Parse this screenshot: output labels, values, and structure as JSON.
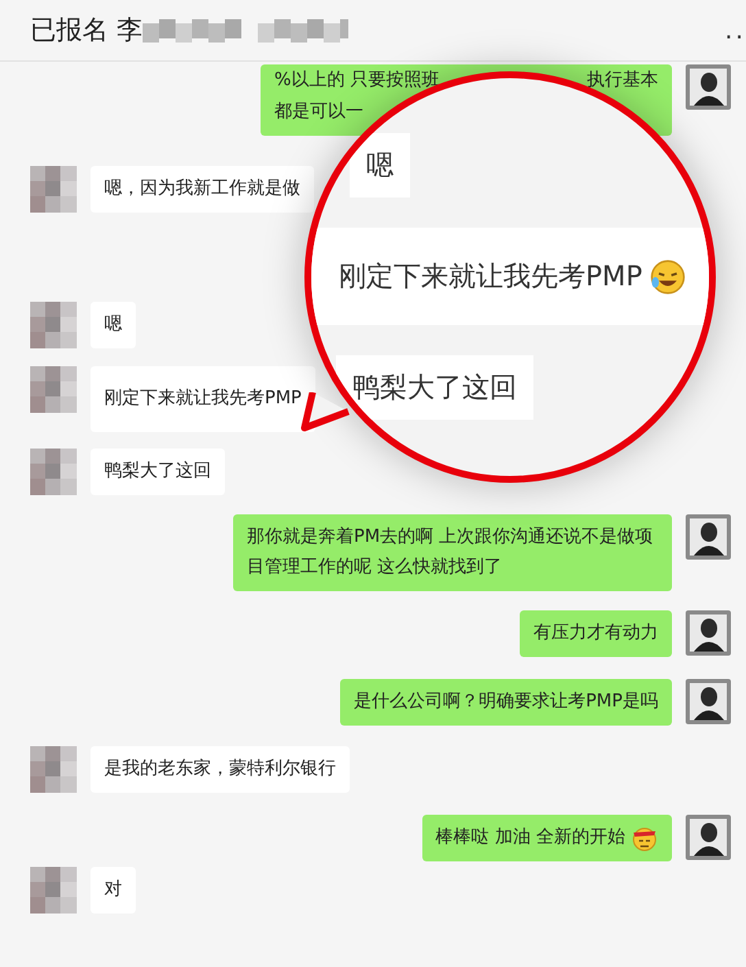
{
  "header": {
    "title": "已报名 李",
    "more": ".."
  },
  "messages": [
    {
      "outgoing": true,
      "kind": "partial",
      "parts": [
        "%以上的 只要按照班",
        "执行基本",
        "都是可以一"
      ]
    },
    {
      "outgoing": false,
      "kind": "text",
      "text": "嗯，因为我新工作就是做"
    },
    {
      "outgoing": false,
      "kind": "text",
      "text": "嗯"
    },
    {
      "outgoing": false,
      "kind": "text",
      "text": "刚定下来就让我先考PMP",
      "tall": true
    },
    {
      "outgoing": false,
      "kind": "text",
      "text": "鸭梨大了这回"
    },
    {
      "outgoing": true,
      "kind": "text",
      "text": "那你就是奔着PM去的啊 上次跟你沟通还说不是做项目管理工作的呢 这么快就找到了"
    },
    {
      "outgoing": true,
      "kind": "text",
      "text": "有压力才有动力"
    },
    {
      "outgoing": true,
      "kind": "text",
      "text": "是什么公司啊？明确要求让考PMP是吗"
    },
    {
      "outgoing": false,
      "kind": "text",
      "text": "是我的老东家，蒙特利尔银行"
    },
    {
      "outgoing": true,
      "kind": "text",
      "text": "棒棒哒 加油  全新的开始",
      "emoji": {
        "kind": "headband"
      }
    },
    {
      "outgoing": false,
      "kind": "text",
      "text": "对"
    }
  ],
  "magnifier": {
    "messages": [
      {
        "text": "嗯"
      },
      {
        "text": "刚定下来就让我先考PMP",
        "emoji": {
          "kind": "laughing"
        }
      },
      {
        "text": "鸭梨大了这回"
      }
    ]
  }
}
